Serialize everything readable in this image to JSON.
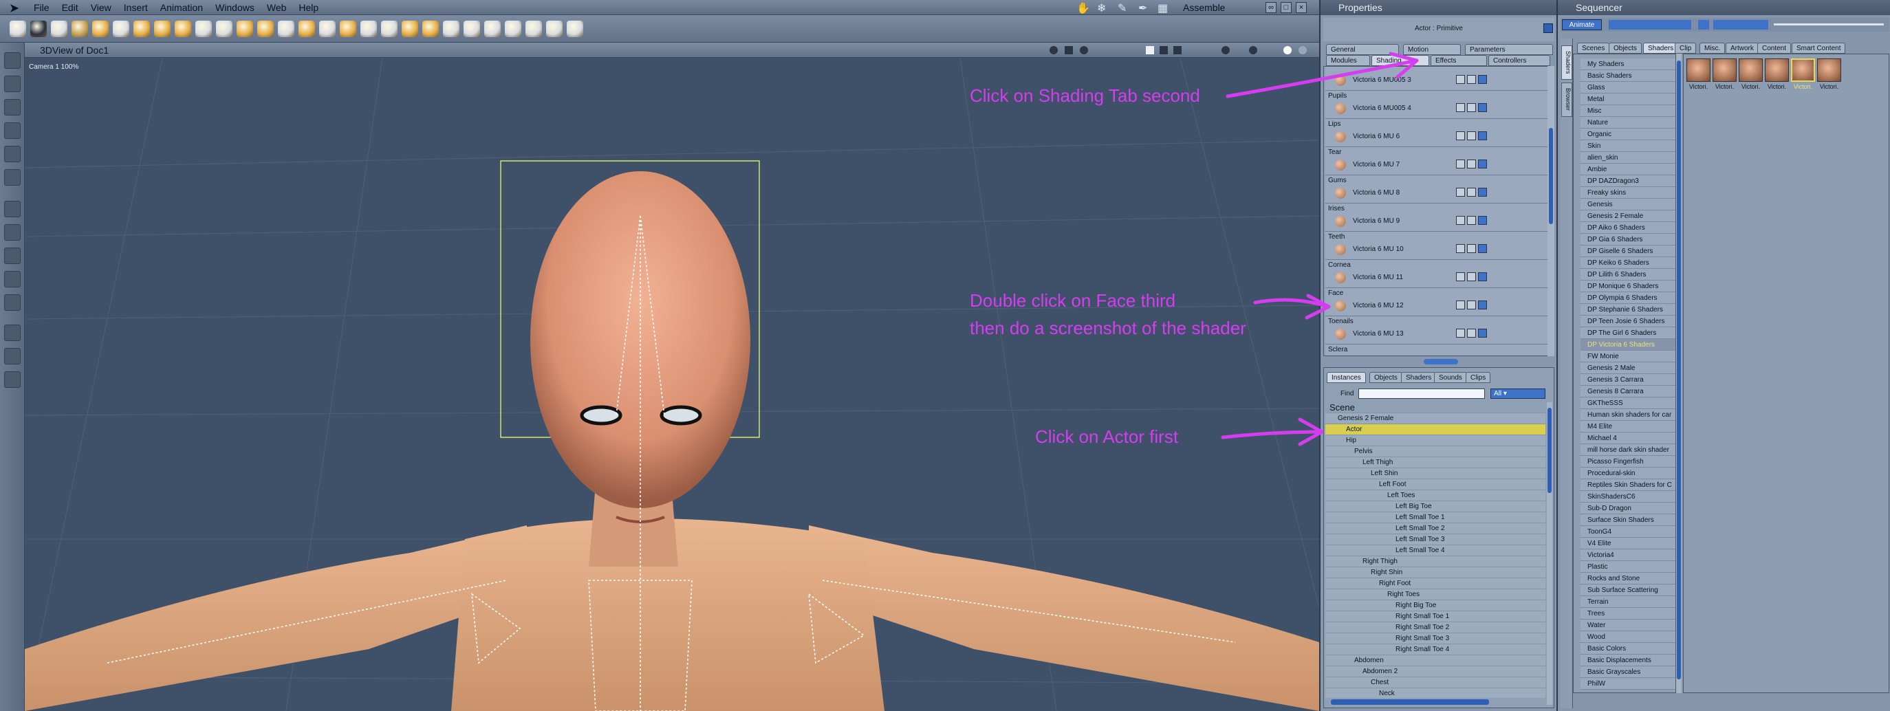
{
  "menubar": {
    "items": [
      "File",
      "Edit",
      "View",
      "Insert",
      "Animation",
      "Windows",
      "Web",
      "Help"
    ],
    "assemble": "Assemble"
  },
  "viewport": {
    "title": "3DView of Doc1",
    "camera": "Camera 1 100%"
  },
  "properties": {
    "title": "Properties",
    "actor_label": "Actor : Primitive",
    "tabs_top": [
      "General",
      "Motion",
      "Parameters"
    ],
    "tabs_bottom": [
      "Modules",
      "Shading",
      "Effects",
      "Controllers"
    ],
    "shaders": [
      {
        "label": "",
        "name": "Victoria 6 MU005 3"
      },
      {
        "label": "Pupils",
        "name": "Victoria 6 MU005 4"
      },
      {
        "label": "Lips",
        "name": "Victoria 6 MU 6"
      },
      {
        "label": "Tear",
        "name": "Victoria 6 MU 7"
      },
      {
        "label": "Gums",
        "name": "Victoria 6 MU 8"
      },
      {
        "label": "Irises",
        "name": "Victoria 6 MU 9"
      },
      {
        "label": "Teeth",
        "name": "Victoria 6 MU 10"
      },
      {
        "label": "Cornea",
        "name": "Victoria 6 MU 11"
      },
      {
        "label": "Face",
        "name": "Victoria 6 MU 12"
      },
      {
        "label": "Toenails",
        "name": "Victoria 6 MU 13"
      },
      {
        "label": "Sclera",
        "name": ""
      }
    ],
    "instance_tabs": [
      "Instances",
      "Objects",
      "Shaders",
      "Sounds",
      "Clips"
    ],
    "find_label": "Find",
    "find_filter": "All",
    "tree": [
      {
        "label": "Scene",
        "depth": 0
      },
      {
        "label": "Genesis 2 Female",
        "depth": 1
      },
      {
        "label": "Actor",
        "depth": 2
      },
      {
        "label": "Hip",
        "depth": 2
      },
      {
        "label": "Pelvis",
        "depth": 3
      },
      {
        "label": "Left Thigh",
        "depth": 4
      },
      {
        "label": "Left Shin",
        "depth": 5
      },
      {
        "label": "Left Foot",
        "depth": 6
      },
      {
        "label": "Left Toes",
        "depth": 7
      },
      {
        "label": "Left Big Toe",
        "depth": 8
      },
      {
        "label": "Left Small Toe 1",
        "depth": 8
      },
      {
        "label": "Left Small Toe 2",
        "depth": 8
      },
      {
        "label": "Left Small Toe 3",
        "depth": 8
      },
      {
        "label": "Left Small Toe 4",
        "depth": 8
      },
      {
        "label": "Right Thigh",
        "depth": 4
      },
      {
        "label": "Right Shin",
        "depth": 5
      },
      {
        "label": "Right Foot",
        "depth": 6
      },
      {
        "label": "Right Toes",
        "depth": 7
      },
      {
        "label": "Right Big Toe",
        "depth": 8
      },
      {
        "label": "Right Small Toe 1",
        "depth": 8
      },
      {
        "label": "Right Small Toe 2",
        "depth": 8
      },
      {
        "label": "Right Small Toe 3",
        "depth": 8
      },
      {
        "label": "Right Small Toe 4",
        "depth": 8
      },
      {
        "label": "Abdomen",
        "depth": 3
      },
      {
        "label": "Abdomen 2",
        "depth": 4
      },
      {
        "label": "Chest",
        "depth": 5
      },
      {
        "label": "Neck",
        "depth": 6
      }
    ]
  },
  "sequencer": {
    "title": "Sequencer",
    "animate_label": "Animate",
    "tabs": [
      "Scenes",
      "Objects",
      "Shaders",
      "Clip",
      "Misc.",
      "Artwork",
      "Content",
      "Smart Content"
    ],
    "side_tabs": [
      "Browser",
      "Shaders"
    ],
    "library": [
      {
        "label": "My Shaders",
        "sel": false
      },
      {
        "label": "Basic Shaders",
        "sel": false
      },
      {
        "label": "Glass",
        "sel": false
      },
      {
        "label": "Metal",
        "sel": false
      },
      {
        "label": "Misc",
        "sel": false
      },
      {
        "label": "Nature",
        "sel": false
      },
      {
        "label": "Organic",
        "sel": false
      },
      {
        "label": "Skin",
        "sel": false
      },
      {
        "label": "alien_skin",
        "sel": false
      },
      {
        "label": "Ambie",
        "sel": false
      },
      {
        "label": "DP DAZDragon3",
        "sel": false
      },
      {
        "label": "Freaky skins",
        "sel": false
      },
      {
        "label": "Genesis",
        "sel": false
      },
      {
        "label": "Genesis 2 Female",
        "sel": false
      },
      {
        "label": "DP Aiko 6 Shaders",
        "sel": false
      },
      {
        "label": "DP Gia 6 Shaders",
        "sel": false
      },
      {
        "label": "DP Giselle 6 Shaders",
        "sel": false
      },
      {
        "label": "DP Keiko 6 Shaders",
        "sel": false
      },
      {
        "label": "DP Lilith 6 Shaders",
        "sel": false
      },
      {
        "label": "DP Monique 6 Shaders",
        "sel": false
      },
      {
        "label": "DP Olympia 6 Shaders",
        "sel": false
      },
      {
        "label": "DP Stephanie 6 Shaders",
        "sel": false
      },
      {
        "label": "DP Teen Josie 6 Shaders",
        "sel": false
      },
      {
        "label": "DP The Girl 6 Shaders",
        "sel": false
      },
      {
        "label": "DP Victoria 6 Shaders",
        "sel": true
      },
      {
        "label": "FW Monie",
        "sel": false
      },
      {
        "label": "Genesis 2 Male",
        "sel": false
      },
      {
        "label": "Genesis 3 Carrara",
        "sel": false
      },
      {
        "label": "Genesis 8 Carrara",
        "sel": false
      },
      {
        "label": "GKTheSSS",
        "sel": false
      },
      {
        "label": "Human skin shaders for car",
        "sel": false
      },
      {
        "label": "M4 Elite",
        "sel": false
      },
      {
        "label": "Michael 4",
        "sel": false
      },
      {
        "label": "mill horse dark skin shader",
        "sel": false
      },
      {
        "label": "Picasso Fingerfish",
        "sel": false
      },
      {
        "label": "Procedural-skin",
        "sel": false
      },
      {
        "label": "Reptiles Skin Shaders for C",
        "sel": false
      },
      {
        "label": "SkinShadersC6",
        "sel": false
      },
      {
        "label": "Sub-D Dragon",
        "sel": false
      },
      {
        "label": "Surface Skin Shaders",
        "sel": false
      },
      {
        "label": "ToonG4",
        "sel": false
      },
      {
        "label": "V4 Elite",
        "sel": false
      },
      {
        "label": "Victoria4",
        "sel": false
      },
      {
        "label": "Plastic",
        "sel": false
      },
      {
        "label": "Rocks and Stone",
        "sel": false
      },
      {
        "label": "Sub Surface Scattering",
        "sel": false
      },
      {
        "label": "Terrain",
        "sel": false
      },
      {
        "label": "Trees",
        "sel": false
      },
      {
        "label": "Water",
        "sel": false
      },
      {
        "label": "Wood",
        "sel": false
      },
      {
        "label": "Basic Colors",
        "sel": false
      },
      {
        "label": "Basic Displacements",
        "sel": false
      },
      {
        "label": "Basic Grayscales",
        "sel": false
      },
      {
        "label": "PhilW",
        "sel": false
      }
    ],
    "thumbs": [
      "Victori.",
      "Victori.",
      "Victori.",
      "Victori.",
      "Victori.",
      "Victori."
    ]
  },
  "annotations": {
    "shading": "Click on Shading Tab second",
    "face_line1": "Double click on Face third",
    "face_line2": "then do a screenshot of the shader",
    "actor": "Click on Actor first",
    "color": "#d63cf0"
  }
}
